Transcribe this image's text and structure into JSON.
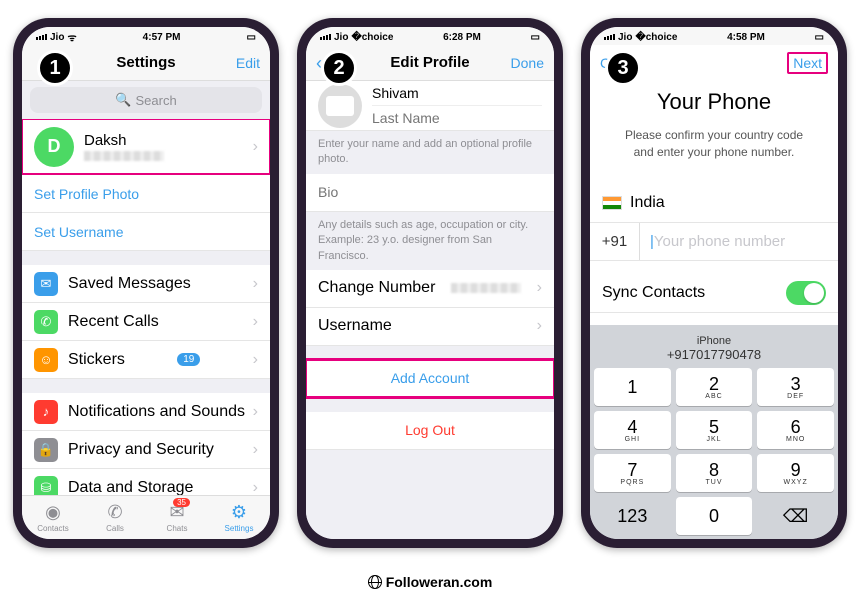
{
  "footer": "Followeran.com",
  "s1": {
    "step": "1",
    "carrier": "Jio",
    "time": "4:57 PM",
    "title": "Settings",
    "edit": "Edit",
    "search": "Search",
    "user": "Daksh",
    "initial": "D",
    "link_photo": "Set Profile Photo",
    "link_user": "Set Username",
    "items": [
      {
        "l": "Saved Messages",
        "c": "ic-blue",
        "g": "✉"
      },
      {
        "l": "Recent Calls",
        "c": "ic-green",
        "g": "✆"
      },
      {
        "l": "Stickers",
        "c": "ic-orange",
        "g": "☺",
        "b": "19"
      }
    ],
    "items2": [
      {
        "l": "Notifications and Sounds",
        "c": "ic-red",
        "g": "♪"
      },
      {
        "l": "Privacy and Security",
        "c": "ic-gray",
        "g": "🔒"
      },
      {
        "l": "Data and Storage",
        "c": "ic-green",
        "g": "⛁"
      }
    ],
    "tabs": [
      {
        "l": "Contacts",
        "g": "◉"
      },
      {
        "l": "Calls",
        "g": "✆"
      },
      {
        "l": "Chats",
        "g": "✉",
        "b": "35"
      },
      {
        "l": "Settings",
        "g": "⚙",
        "a": true
      }
    ]
  },
  "s2": {
    "step": "2",
    "carrier": "Jio",
    "time": "6:28 PM",
    "back": "B",
    "title": "Edit Profile",
    "done": "Done",
    "first": "Shivam",
    "last_ph": "Last Name",
    "hint1": "Enter your name and add an optional profile photo.",
    "bio_ph": "Bio",
    "hint2": "Any details such as age, occupation or city. Example: 23 y.o. designer from San Francisco.",
    "change": "Change Number",
    "username": "Username",
    "add": "Add Account",
    "logout": "Log Out"
  },
  "s3": {
    "step": "3",
    "carrier": "Jio",
    "time": "4:58 PM",
    "cancel": "Canc",
    "next": "Next",
    "title": "Your Phone",
    "sub": "Please confirm your country code and enter your phone number.",
    "country": "India",
    "cc": "+91",
    "ph": "Your phone number",
    "sync": "Sync Contacts",
    "kp_label": "iPhone",
    "kp_num": "+917017790478",
    "keys": [
      {
        "d": "1",
        "l": ""
      },
      {
        "d": "2",
        "l": "ABC"
      },
      {
        "d": "3",
        "l": "DEF"
      },
      {
        "d": "4",
        "l": "GHI"
      },
      {
        "d": "5",
        "l": "JKL"
      },
      {
        "d": "6",
        "l": "MNO"
      },
      {
        "d": "7",
        "l": "PQRS"
      },
      {
        "d": "8",
        "l": "TUV"
      },
      {
        "d": "9",
        "l": "WXYZ"
      },
      {
        "d": "123",
        "fn": true
      },
      {
        "d": "0",
        "l": ""
      },
      {
        "d": "⌫",
        "fn": true
      }
    ]
  }
}
